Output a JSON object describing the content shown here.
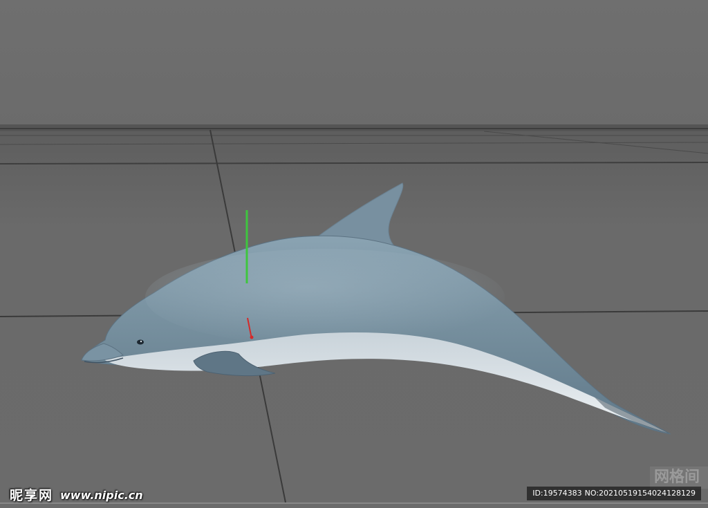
{
  "viewport": {
    "grid_label": "网格间",
    "object": "dolphin-model"
  },
  "watermark": {
    "site_name": "昵享网",
    "url": "www.nipic.cn",
    "id_text": "ID:19574383",
    "no_text": "NO:20210519154024128129"
  },
  "colors": {
    "background": "#6b6b6b",
    "dolphin_back": "#7f97a6",
    "dolphin_belly": "#e2e7ea",
    "axis_y": "#3ec63e",
    "axis_x": "#d42a2a",
    "grid_line": "#3a3a3a"
  }
}
